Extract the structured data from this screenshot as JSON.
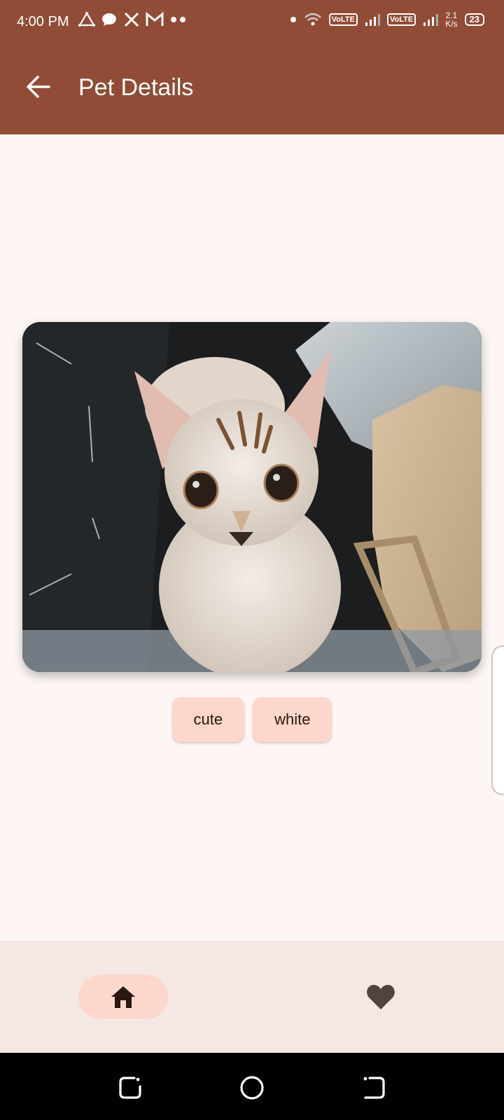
{
  "status_bar": {
    "time": "4:00 PM",
    "left_icons": [
      "triangle-app-icon",
      "chat-bubble-icon",
      "x-icon",
      "gmail-icon",
      "more-dots-icon"
    ],
    "volte_1": "VoLTE",
    "volte_2": "VoLTE",
    "net_speed_value": "2.1",
    "net_speed_unit": "K/s",
    "battery": "23"
  },
  "app_bar": {
    "title": "Pet Details",
    "back_icon": "arrow-back-icon",
    "color": "#914c37"
  },
  "pet": {
    "tags": [
      "cute",
      "white"
    ]
  },
  "bottom_nav": {
    "items": [
      {
        "icon": "home-icon",
        "selected": true
      },
      {
        "icon": "heart-icon",
        "selected": false
      }
    ],
    "accent": "#fdd7cc"
  },
  "system_nav": {
    "buttons": [
      "recents-icon",
      "home-circle-icon",
      "back-icon"
    ]
  }
}
